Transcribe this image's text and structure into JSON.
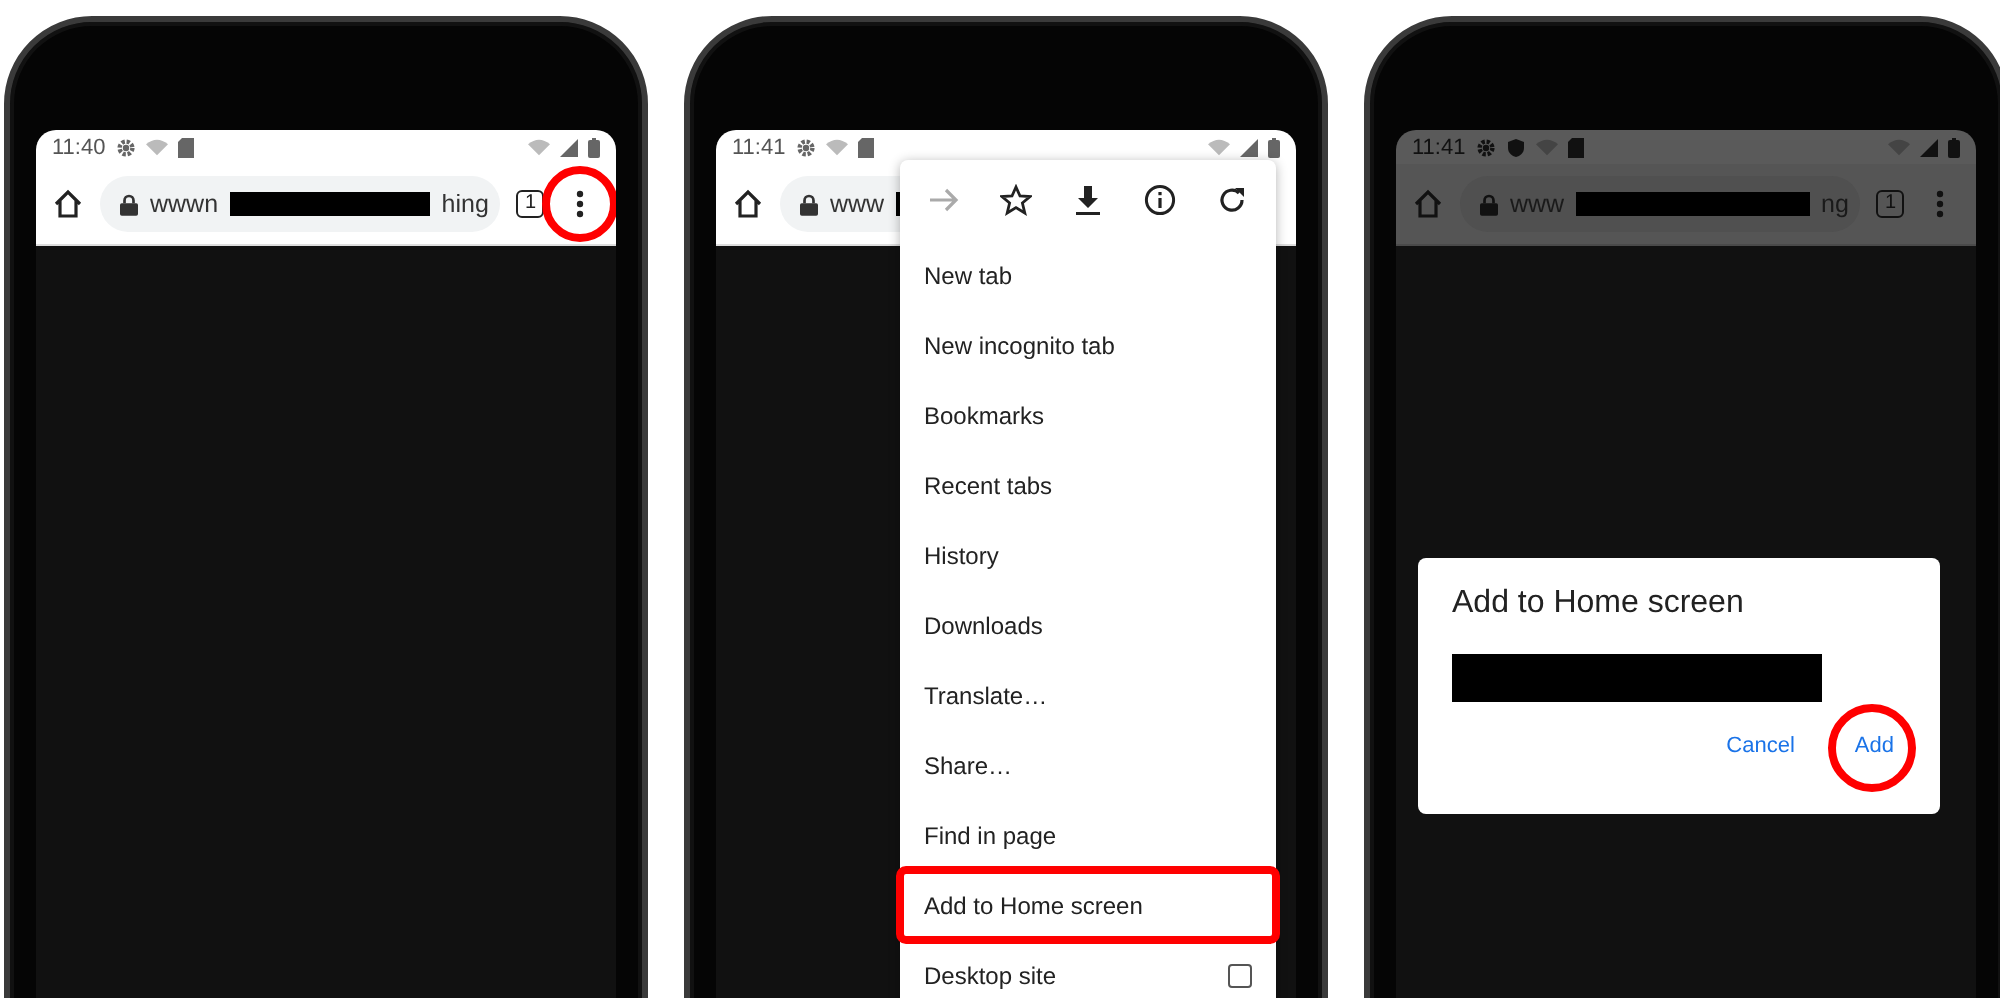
{
  "phones": [
    {
      "time": "11:40",
      "shield_shown": false,
      "dimmed": false,
      "url_start": "wwwn",
      "url_end": "hing",
      "tab_count": "1",
      "menu_button_highlighted": true
    },
    {
      "time": "11:41",
      "shield_shown": false,
      "dimmed": false,
      "url_start": "www",
      "menu_button_highlighted": false,
      "menu": {
        "forward_disabled": true,
        "items": [
          {
            "label": "New tab",
            "kind": "item",
            "highlighted": false
          },
          {
            "label": "New incognito tab",
            "kind": "item",
            "highlighted": false
          },
          {
            "label": "Bookmarks",
            "kind": "item",
            "highlighted": false
          },
          {
            "label": "Recent tabs",
            "kind": "item",
            "highlighted": false
          },
          {
            "label": "History",
            "kind": "item",
            "highlighted": false
          },
          {
            "label": "Downloads",
            "kind": "item",
            "highlighted": false
          },
          {
            "label": "Translate…",
            "kind": "item",
            "highlighted": false
          },
          {
            "label": "Share…",
            "kind": "item",
            "highlighted": false
          },
          {
            "label": "Find in page",
            "kind": "item",
            "highlighted": false
          },
          {
            "label": "Add to Home screen",
            "kind": "item",
            "highlighted": true
          },
          {
            "label": "Desktop site",
            "kind": "checkbox",
            "checked": false,
            "highlighted": false
          }
        ]
      }
    },
    {
      "time": "11:41",
      "shield_shown": true,
      "dimmed": true,
      "url_start": "www",
      "url_end": "ng",
      "tab_count": "1",
      "menu_button_highlighted": false,
      "dialog": {
        "title": "Add to Home screen",
        "buttons": [
          {
            "label": "Cancel",
            "highlighted": false
          },
          {
            "label": "Add",
            "highlighted": true
          }
        ]
      }
    }
  ]
}
